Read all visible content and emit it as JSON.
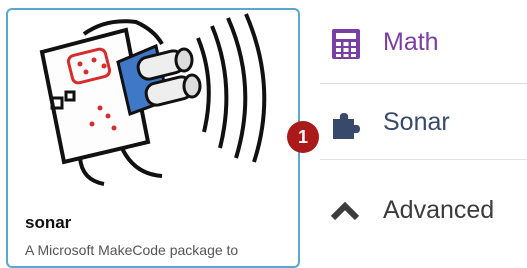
{
  "package_card": {
    "title": "sonar",
    "description": "A Microsoft MakeCode package to"
  },
  "badge": {
    "number": "1"
  },
  "toolbox": {
    "items": [
      {
        "label": "Math",
        "icon": "calculator-icon",
        "color": "#7a3fa4"
      },
      {
        "label": "Sonar",
        "icon": "puzzle-piece-icon",
        "color": "#384a6b"
      },
      {
        "label": "Advanced",
        "icon": "chevron-up-icon",
        "color": "#3c3c3c"
      }
    ]
  }
}
